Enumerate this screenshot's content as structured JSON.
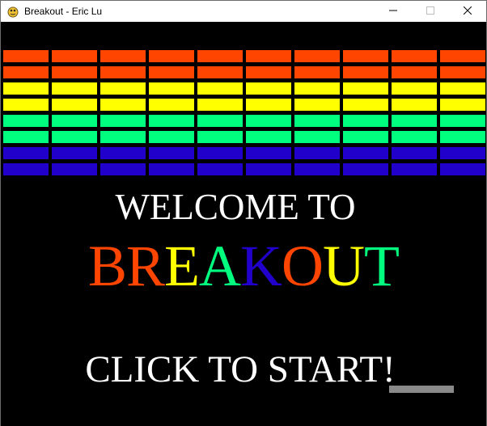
{
  "window": {
    "title": "Breakout - Eric Lu",
    "controls": [
      "minimize-icon",
      "maximize-icon",
      "close-icon"
    ]
  },
  "game": {
    "welcome_text": "WELCOME TO",
    "title_letters": [
      "B",
      "R",
      "E",
      "A",
      "K",
      "O",
      "U",
      "T"
    ],
    "title_colors": [
      "#ff4500",
      "#ff4500",
      "#ffff00",
      "#00ff7f",
      "#2200cc",
      "#ff4500",
      "#ffff00",
      "#00ff7f",
      "#2200cc"
    ],
    "start_text": "CLICK TO START!",
    "brick_columns": 10,
    "brick_row_colors": [
      "#ff4500",
      "#ff4500",
      "#ffff00",
      "#ffff00",
      "#00ff7f",
      "#00ff7f",
      "#2200cc",
      "#2200cc"
    ],
    "colors": {
      "background": "#000000",
      "paddle": "#8a8a8a",
      "text": "#ffffff"
    }
  }
}
